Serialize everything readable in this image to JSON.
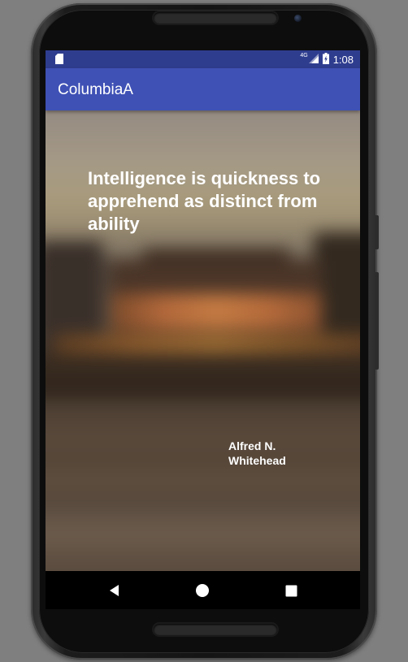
{
  "status_bar": {
    "left_icon": "sim-card-icon",
    "network_type": "4G",
    "signal_icon": "cell-signal-icon",
    "battery_icon": "battery-charging-icon",
    "time": "1:08"
  },
  "app_bar": {
    "title": "ColumbiaA"
  },
  "quote": {
    "text": "Intelligence is quickness to apprehend as distinct from ability",
    "author": "Alfred N. Whitehead"
  },
  "nav_bar": {
    "back_icon": "back-triangle-icon",
    "home_icon": "home-circle-icon",
    "recents_icon": "recents-square-icon"
  },
  "colors": {
    "status_bar": "#2f3d8f",
    "app_bar": "#3f51b5",
    "text": "#ffffff"
  }
}
